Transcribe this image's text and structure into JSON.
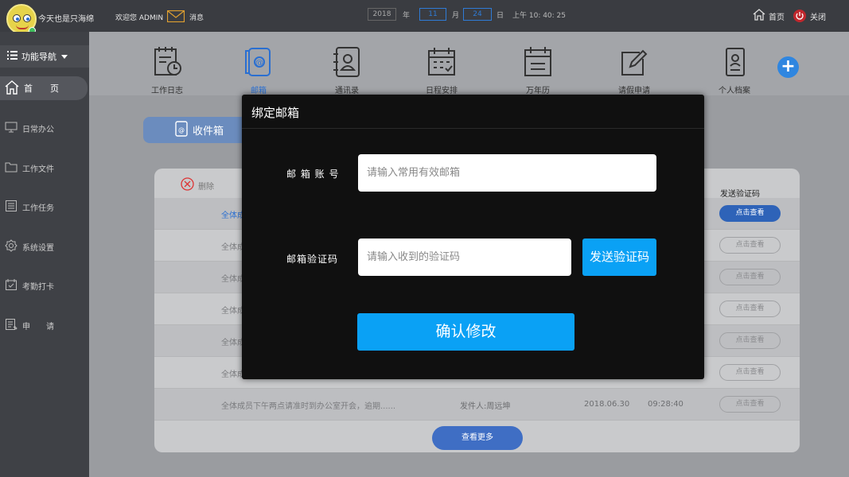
{
  "header": {
    "username": "今天也是只海绵",
    "welcome": "欢迎您 ADMIN",
    "messages": "消息",
    "date": {
      "year": "2018",
      "year_unit": "年",
      "month": "11",
      "month_unit": "月",
      "day": "24",
      "day_unit": "日"
    },
    "time": "上午 10: 40: 25",
    "home": "首页",
    "close": "关闭"
  },
  "sidebar": {
    "func_nav": "功能导航",
    "home": "首　　页",
    "items": [
      {
        "label": "日常办公",
        "icon": "monitor-icon"
      },
      {
        "label": "工作文件",
        "icon": "folder-icon"
      },
      {
        "label": "工作任务",
        "icon": "list-icon"
      },
      {
        "label": "系统设置",
        "icon": "gear-icon"
      },
      {
        "label": "考勤打卡",
        "icon": "calendar-check-icon"
      },
      {
        "label": "申　　请",
        "icon": "form-icon"
      }
    ]
  },
  "toolbar": {
    "items": [
      {
        "label": "工作日志",
        "icon": "work-log-icon"
      },
      {
        "label": "邮箱",
        "icon": "mailbox-icon"
      },
      {
        "label": "通讯录",
        "icon": "contacts-icon"
      },
      {
        "label": "日程安排",
        "icon": "schedule-icon"
      },
      {
        "label": "万年历",
        "icon": "calendar-icon"
      },
      {
        "label": "请假申请",
        "icon": "leave-edit-icon"
      },
      {
        "label": "个人档案",
        "icon": "profile-icon"
      }
    ],
    "add": "+"
  },
  "mail": {
    "inbox_tab": "收件箱",
    "delete": "删除",
    "col_code": "发送验证码",
    "view_more": "查看更多",
    "rows": [
      {
        "title": "全体成",
        "sender": "",
        "date": "",
        "time": "",
        "action": "点击查看",
        "active": true
      },
      {
        "title": "全体成",
        "sender": "",
        "date": "",
        "time": "",
        "action": "点击查看",
        "active": false
      },
      {
        "title": "全体成",
        "sender": "",
        "date": "",
        "time": "",
        "action": "点击查看",
        "active": false
      },
      {
        "title": "全体成",
        "sender": "",
        "date": "",
        "time": "",
        "action": "点击查看",
        "active": false
      },
      {
        "title": "全体成",
        "sender": "",
        "date": "",
        "time": "",
        "action": "点击查看",
        "active": false
      },
      {
        "title": "全体成",
        "sender": "",
        "date": "",
        "time": "",
        "action": "点击查看",
        "active": false
      },
      {
        "title": "全体成员下午两点请准时到办公室开会，逾期......",
        "sender": "发件人:周远坤",
        "date": "2018.06.30",
        "time": "09:28:40",
        "action": "点击查看",
        "active": false
      }
    ]
  },
  "modal": {
    "title": "绑定邮箱",
    "email_label": "邮 箱 账 号",
    "email_placeholder": "请输入常用有效邮箱",
    "code_label": "邮箱验证码",
    "code_placeholder": "请输入收到的验证码",
    "send_code": "发送验证码",
    "confirm": "确认修改"
  },
  "colors": {
    "accent": "#0aa1f5",
    "modal_bg": "#101010",
    "active_blue": "#2e63b8"
  }
}
